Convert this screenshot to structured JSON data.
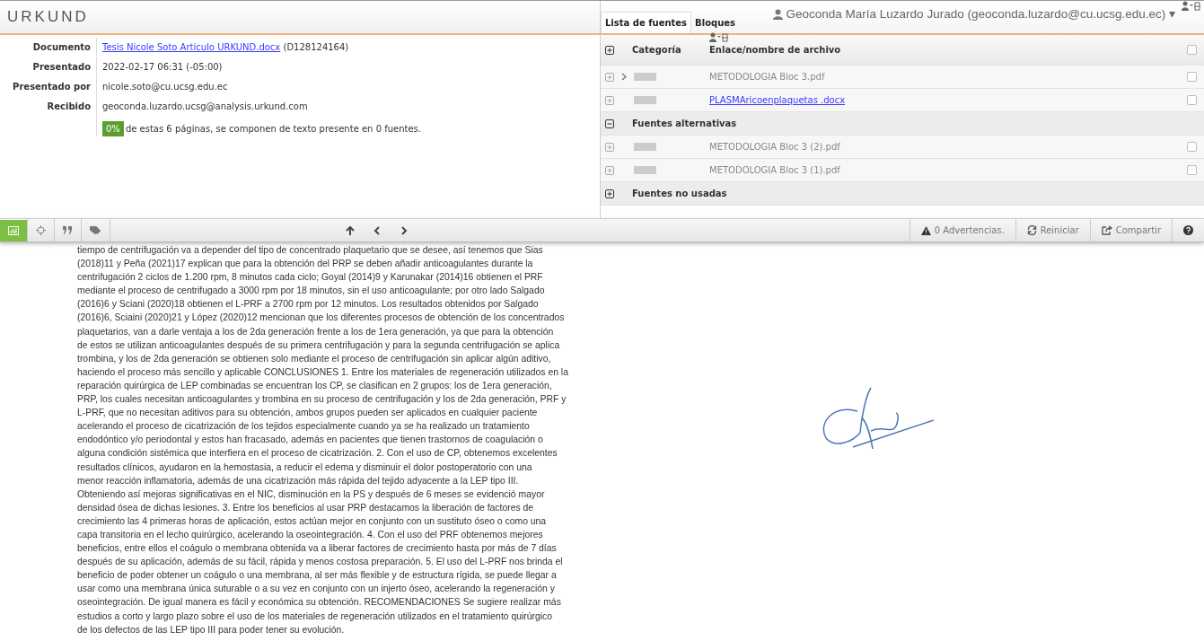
{
  "header": {
    "logo": "URKUND",
    "user": "Geoconda María Luzardo Jurado (geoconda.luzardo@cu.ucsg.edu.ec)",
    "user_caret": "▾"
  },
  "details": [
    {
      "label": "Documento",
      "value": "Tesis Nicole Soto Articulo URKUND.docx",
      "extra": "(D128124164)",
      "kind": "link"
    },
    {
      "label": "Presentado",
      "value": "2022-02-17 06:31 (-05:00)",
      "kind": "text"
    },
    {
      "label": "Presentado por",
      "value": "nicole.soto@cu.ucsg.edu.ec",
      "kind": "text"
    },
    {
      "label": "Recibido",
      "value": "geoconda.luzardo.ucsg@analysis.urkund.com",
      "kind": "text"
    }
  ],
  "summary": {
    "percent": "0%",
    "text": "de estas 6 páginas, se componen de texto presente en 0 fuentes."
  },
  "tabs": [
    {
      "label": "Lista de fuentes",
      "selected": true
    },
    {
      "label": "Bloques",
      "selected": false
    }
  ],
  "sources": {
    "columns": [
      "Categoría",
      "Enlace/nombre de archivo"
    ],
    "all_checked": false,
    "rows": [
      {
        "kind": "source",
        "name": "METODOLOGIA Bloc 3.pdf",
        "link": false,
        "arrow": true,
        "checked": false
      },
      {
        "kind": "source",
        "name": "PLASMAricoenplaquetas .docx",
        "link": true,
        "arrow": false,
        "checked": false
      },
      {
        "kind": "group",
        "name": "Fuentes alternativas",
        "expanded": true
      },
      {
        "kind": "source",
        "name": "METODOLOGIA Bloc 3 (2).pdf",
        "link": false,
        "arrow": false,
        "checked": false
      },
      {
        "kind": "source",
        "name": "METODOLOGIA Bloc 3 (1).pdf",
        "link": false,
        "arrow": false,
        "checked": false
      },
      {
        "kind": "group",
        "name": "Fuentes no usadas",
        "expanded": false
      }
    ]
  },
  "toolbar": {
    "left": [
      {
        "kind": "chart",
        "selected": true
      },
      {
        "kind": "target",
        "selected": false
      },
      {
        "kind": "quote",
        "selected": false
      },
      {
        "kind": "tag",
        "selected": false
      }
    ],
    "warnings": "0 Advertencias.",
    "restart": "Reiniciar",
    "share": "Compartir"
  },
  "document": {
    "lines": [
      "tiempo de centrifugación va a depender del tipo de concentrado plaquetario que se desee, así tenemos que Sias",
      "(2018)11 y Peña (2021)17 explican que para la obtención del PRP se deben añadir anticoagulantes durante la",
      "centrifugación 2 ciclos de 1.200 rpm, 8 minutos cada ciclo; Goyal (2014)9 y Karunakar (2014)16 obtienen el PRF",
      "mediante el proceso de centrifugado a 3000 rpm por 18 minutos, sin el uso anticoagulante; por otro lado Salgado",
      "(2016)6 y Sciani (2020)18 obtienen el L-PRF a 2700 rpm por 12 minutos. Los resultados obtenidos por Salgado",
      "(2016)6, Sciaini (2020)21 y López (2020)12 mencionan que los diferentes procesos de obtención de los concentrados",
      "plaquetarios, van a darle ventaja a los de 2da generación frente a los de 1era generación, ya que para la obtención",
      "de estos se utilizan anticoagulantes después de su primera centrifugación y para la segunda centrifugación se aplica",
      "trombina, y los de 2da generación se obtienen solo mediante el proceso de centrifugación sin aplicar algún aditivo,",
      "haciendo el proceso más sencillo y aplicable CONCLUSIONES 1. Entre los materiales de regeneración utilizados en la",
      "reparación quirúrgica de LEP combinadas se encuentran los CP, se clasifican en 2 grupos: los de 1era generación,",
      "PRP, los cuales necesitan anticoagulantes y trombina en su proceso de centrifugación y los de 2da generación, PRF y",
      "L-PRF, que no necesitan aditivos para su obtención, ambos grupos pueden ser aplicados en cualquier paciente",
      "acelerando el proceso de cicatrización de los tejidos especialmente cuando ya se ha realizado un tratamiento",
      "endodóntico y/o periodontal y estos han fracasado, además en pacientes que tienen trastornos de coagulación o",
      "alguna condición sistémica que interfiera en el proceso de cicatrización. 2. Con el uso de CP, obtenemos excelentes",
      "resultados clínicos, ayudaron en la hemostasia, a reducir el edema y disminuir el dolor postoperatorio con una",
      "menor reacción inflamatoria, además de una cicatrización más rápida del tejido adyacente a la LEP tipo III.",
      "Obteniendo así mejoras significativas en el NIC, disminución en la PS y después de 6 meses se evidenció mayor",
      "densidad ósea de dichas lesiones. 3. Entre los beneficios al usar PRP destacamos la liberación de factores de",
      "crecimiento las 4 primeras horas de aplicación, estos actúan mejor en conjunto con un sustituto óseo o como una",
      "capa transitoria en el lecho quirúrgico, acelerando la oseointegración. 4. Con el uso del PRF obtenemos mejores",
      "beneficios, entre ellos el coágulo o membrana obtenida va a liberar factores de crecimiento hasta por más de 7 días",
      "después de su aplicación, además de su fácil, rápida y menos costosa preparación. 5. El uso del L-PRF nos brinda el",
      "beneficio de poder obtener un coágulo o una membrana, al ser más flexible y de estructura rígida, se puede llegar a",
      "usar como una membrana única suturable o a su vez en conjunto con un injerto óseo, acelerando la regeneración y",
      "oseointegración. De igual manera es fácil y económica su obtención. RECOMENDACIONES Se sugiere realizar más",
      "estudios a corto y largo plazo sobre el uso de los materiales de regeneración utilizados en el tratamiento quirúrgico",
      "de los defectos de las LEP tipo III para poder tener su evolución."
    ]
  }
}
